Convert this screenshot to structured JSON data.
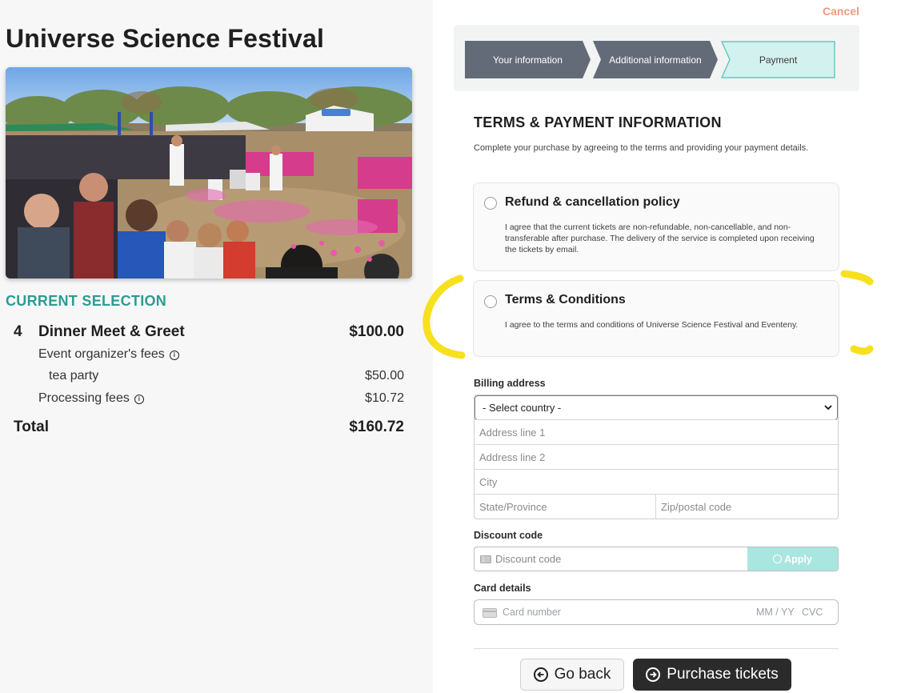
{
  "event": {
    "title": "Universe Science Festival",
    "photo_alt": "festival-crowd-photo"
  },
  "selection": {
    "heading": "CURRENT SELECTION",
    "item": {
      "qty": "4",
      "name": "Dinner Meet & Greet",
      "price": "$100.00"
    },
    "organizer_fees_label": "Event organizer's fees",
    "tea_party": {
      "label": "tea party",
      "price": "$50.00"
    },
    "processing": {
      "label": "Processing fees",
      "price": "$10.72"
    },
    "total": {
      "label": "Total",
      "price": "$160.72"
    }
  },
  "header": {
    "cancel_label": "Cancel"
  },
  "steps": [
    {
      "label": "Your information",
      "state": "done"
    },
    {
      "label": "Additional information",
      "state": "done"
    },
    {
      "label": "Payment",
      "state": "current"
    }
  ],
  "terms": {
    "title": "TERMS & PAYMENT INFORMATION",
    "subtitle": "Complete your purchase by agreeing to the terms and providing your payment details.",
    "refund": {
      "title": "Refund & cancellation policy",
      "text": "I agree that the current tickets are non-refundable, non-cancellable, and non-transferable after purchase. The delivery of the service is completed upon receiving the tickets by email."
    },
    "conditions": {
      "title": "Terms & Conditions",
      "text": "I agree to the terms and conditions of Universe Science Festival and Eventeny."
    }
  },
  "billing": {
    "label": "Billing address",
    "country_selected": "- Select country -",
    "address1_placeholder": "Address line 1",
    "address2_placeholder": "Address line 2",
    "city_placeholder": "City",
    "state_placeholder": "State/Province",
    "zip_placeholder": "Zip/postal code"
  },
  "discount": {
    "label": "Discount code",
    "placeholder": "Discount code",
    "apply_label": "Apply"
  },
  "card": {
    "label": "Card details",
    "number_placeholder": "Card number",
    "expiry_placeholder": "MM / YY",
    "cvc_placeholder": "CVC"
  },
  "actions": {
    "back_label": "Go back",
    "purchase_label": "Purchase tickets"
  },
  "colors": {
    "accent_teal": "#2a9d92",
    "step_done": "#646b78",
    "step_current": "#d3f1ee",
    "cancel": "#f29a7e",
    "apply_bg": "#a9e6e0",
    "highlight_marker": "#f7e01d"
  }
}
